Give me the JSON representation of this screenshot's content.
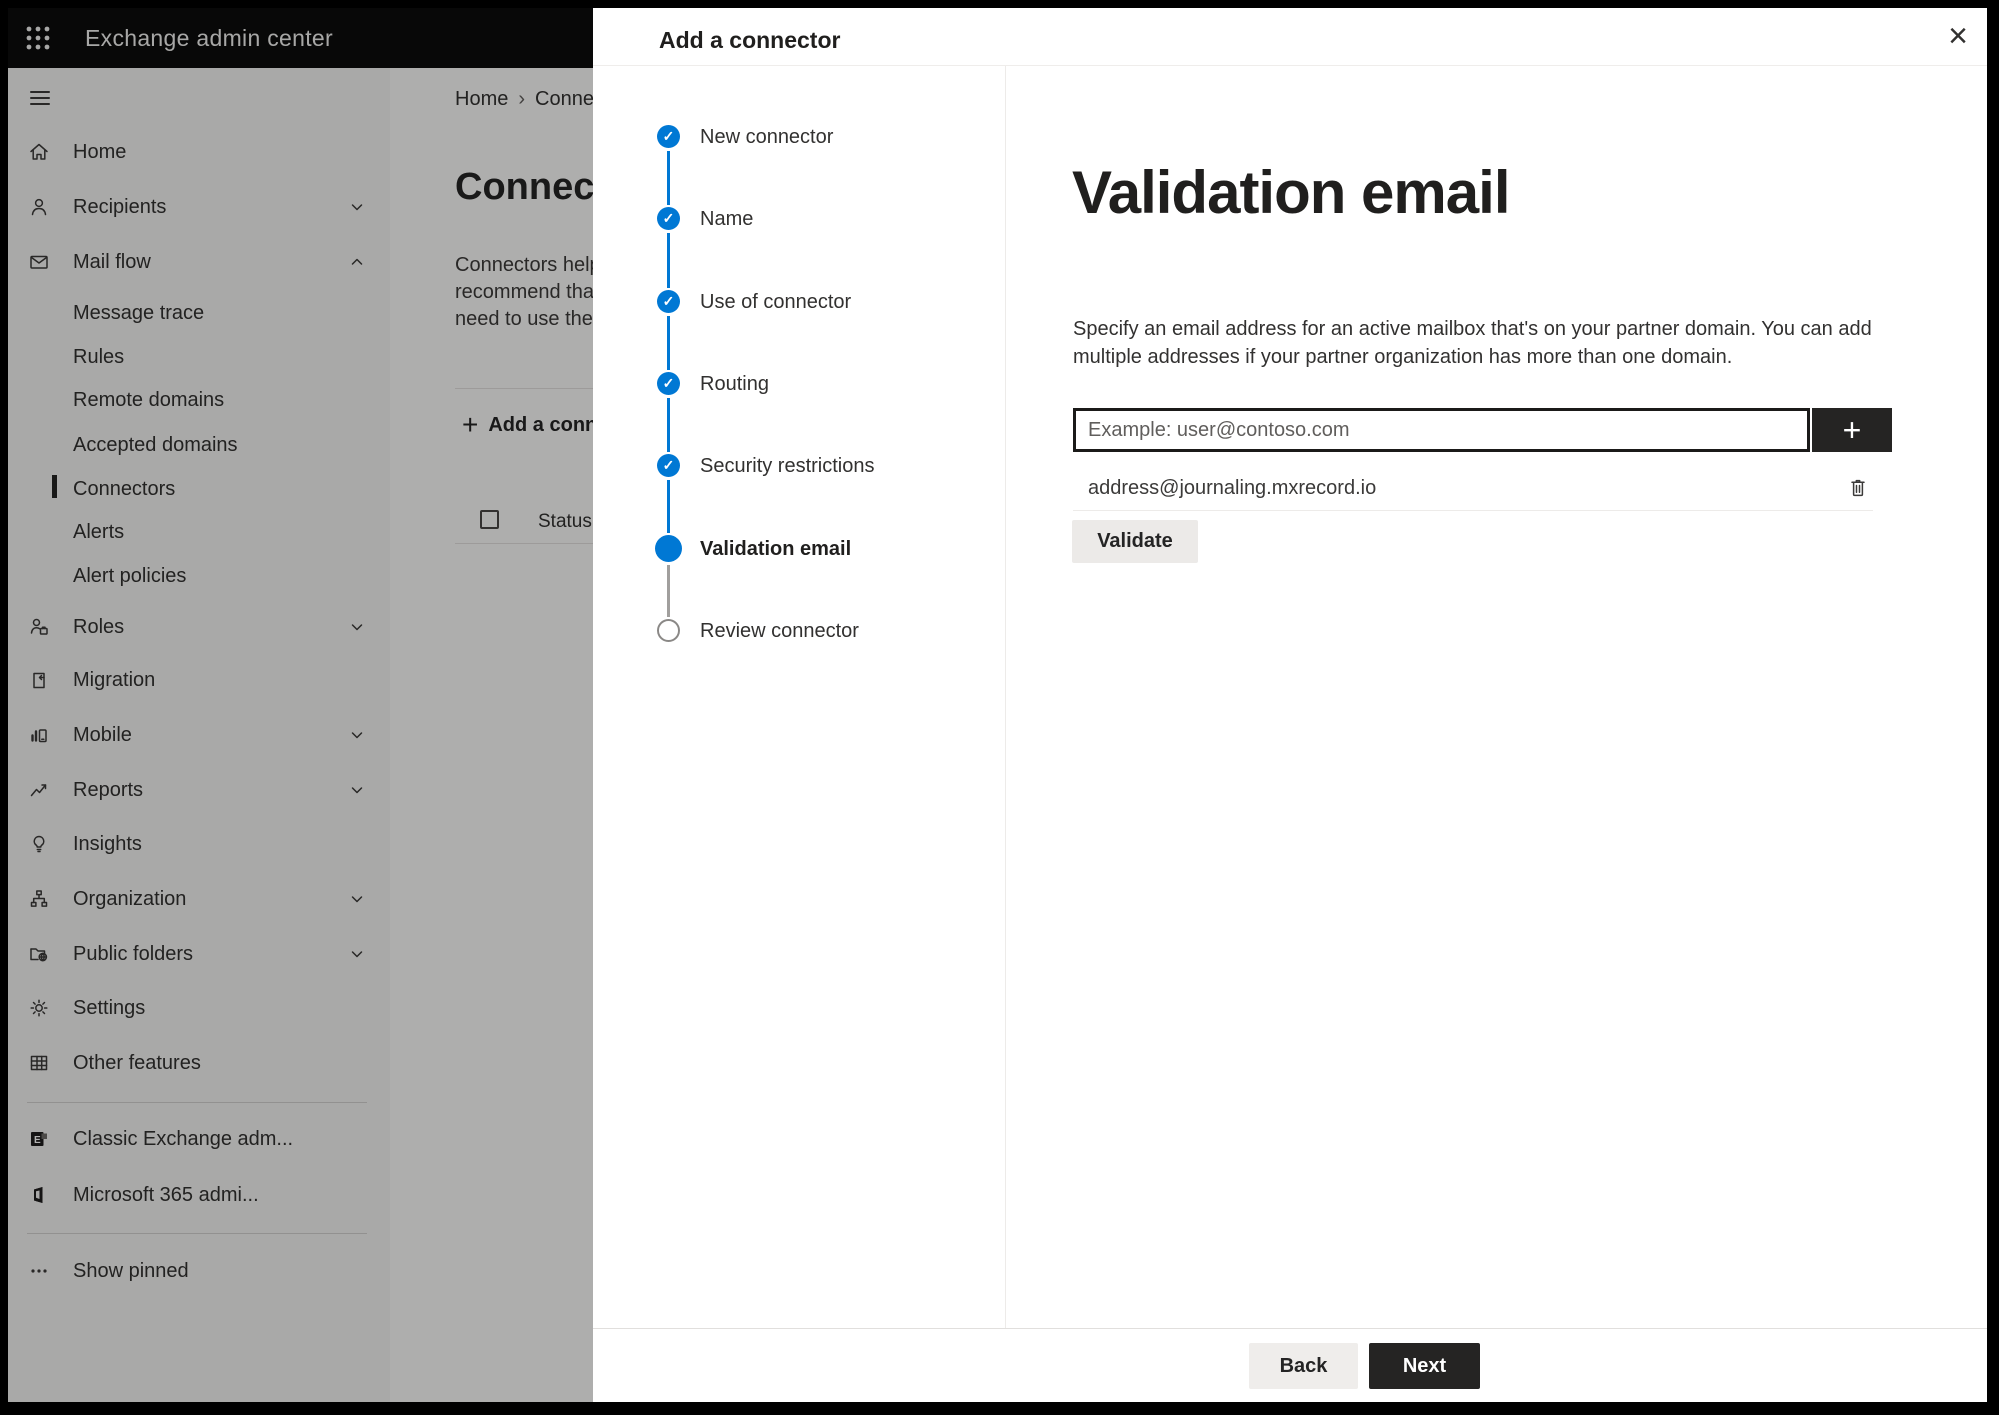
{
  "topbar": {
    "title": "Exchange admin center",
    "app_launcher_icon": "waffle-grid"
  },
  "sidebar": {
    "hamburger_icon": "hamburger",
    "items": [
      {
        "label": "Home",
        "icon": "home"
      },
      {
        "label": "Recipients",
        "icon": "person",
        "chevron": "down"
      },
      {
        "label": "Mail flow",
        "icon": "mail",
        "chevron": "up",
        "expanded": true
      },
      {
        "label": "Message trace",
        "indent": true
      },
      {
        "label": "Rules",
        "indent": true
      },
      {
        "label": "Remote domains",
        "indent": true
      },
      {
        "label": "Accepted domains",
        "indent": true
      },
      {
        "label": "Connectors",
        "indent": true,
        "selected": true
      },
      {
        "label": "Alerts",
        "indent": true
      },
      {
        "label": "Alert policies",
        "indent": true
      },
      {
        "label": "Roles",
        "icon": "roles",
        "chevron": "down"
      },
      {
        "label": "Migration",
        "icon": "migration"
      },
      {
        "label": "Mobile",
        "icon": "mobile",
        "chevron": "down"
      },
      {
        "label": "Reports",
        "icon": "reports",
        "chevron": "down"
      },
      {
        "label": "Insights",
        "icon": "lightbulb"
      },
      {
        "label": "Organization",
        "icon": "org-chart",
        "chevron": "down"
      },
      {
        "label": "Public folders",
        "icon": "folder-globe",
        "chevron": "down"
      },
      {
        "label": "Settings",
        "icon": "gear"
      },
      {
        "label": "Other features",
        "icon": "grid-table"
      },
      {
        "label": "Classic Exchange adm...",
        "icon": "exchange-logo"
      },
      {
        "label": "Microsoft 365 admi...",
        "icon": "microsoft-365-logo"
      },
      {
        "label": "Show pinned",
        "icon": "ellipsis"
      }
    ]
  },
  "page": {
    "breadcrumb": {
      "home": "Home",
      "separator": "›",
      "current": "Connectors"
    },
    "title": "Connectors",
    "description_lines": [
      "Connectors help",
      "recommend that",
      "need to use ther"
    ],
    "add_button_icon": "+",
    "add_button_label": "Add a connector",
    "status_header": "Status"
  },
  "dialog": {
    "title": "Add a connector",
    "close_glyph": "×",
    "check_glyph": "✓",
    "steps": [
      {
        "label": "New connector",
        "state": "complete"
      },
      {
        "label": "Name",
        "state": "complete"
      },
      {
        "label": "Use of connector",
        "state": "complete"
      },
      {
        "label": "Routing",
        "state": "complete"
      },
      {
        "label": "Security restrictions",
        "state": "complete"
      },
      {
        "label": "Validation email",
        "state": "current"
      },
      {
        "label": "Review connector",
        "state": "upcoming"
      }
    ],
    "content": {
      "heading": "Validation email",
      "description_lines": [
        "Specify an email address for an active mailbox that's on your partner domain. You can add",
        "multiple addresses if your partner organization has more than one domain."
      ],
      "email_input": {
        "value": "",
        "placeholder": "Example: user@contoso.com"
      },
      "add_address_glyph": "+",
      "addresses": [
        {
          "email": "address@journaling.mxrecord.io"
        }
      ],
      "validate_button": "Validate"
    },
    "footer": {
      "back_button": "Back",
      "next_button": "Next"
    }
  },
  "colors": {
    "accent_blue": "#0078d4",
    "dark_button": "#252423",
    "topbar_bg": "#0c0c0c"
  }
}
